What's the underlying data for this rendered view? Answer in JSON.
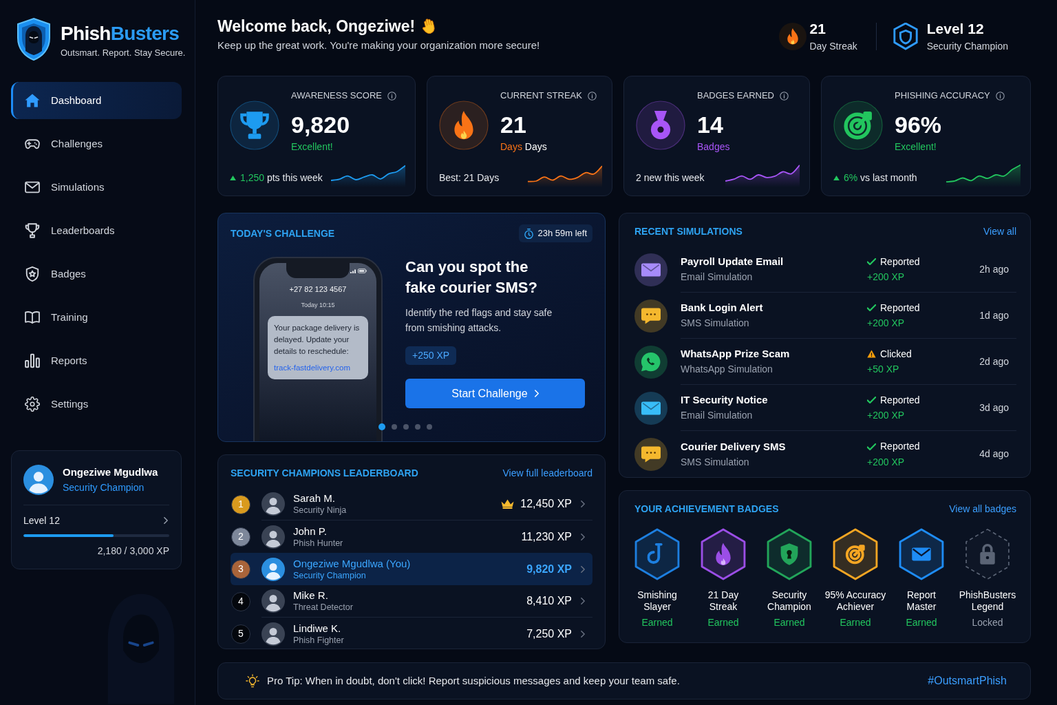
{
  "brand": {
    "name_start": "Phish",
    "name_end": "Busters",
    "tagline": "Outsmart. Report. Stay Secure."
  },
  "sidebar": {
    "items": [
      {
        "label": "Dashboard",
        "selected": true
      },
      {
        "label": "Challenges",
        "selected": false
      },
      {
        "label": "Simulations",
        "selected": false
      },
      {
        "label": "Leaderboards",
        "selected": false
      },
      {
        "label": "Badges",
        "selected": false
      },
      {
        "label": "Training",
        "selected": false
      },
      {
        "label": "Reports",
        "selected": false
      },
      {
        "label": "Settings",
        "selected": false
      }
    ],
    "profile": {
      "name": "Ongeziwe Mgudlwa",
      "role": "Security Champion",
      "level_label": "Level 12",
      "level": 0.62,
      "xp": "2,180 / 3,000 XP"
    }
  },
  "header": {
    "greeting": "Welcome back, Ongeziwe!",
    "subtitle": "Keep up the great work. You're making your organization more secure!",
    "streak": {
      "value": "21",
      "label": "Day Streak"
    },
    "rank": {
      "value": "Level 12",
      "label": "Security Champion"
    }
  },
  "stats": [
    {
      "title": "AWARENESS SCORE",
      "value": "9,820",
      "color": "#1d9bf0",
      "sub": {
        "accent": "Excellent!",
        "positive": true
      },
      "footer": {
        "trend_up": true,
        "accent": "1,250",
        "text": "pts this week"
      }
    },
    {
      "title": "CURRENT STREAK",
      "value": "21",
      "color": "#f97316",
      "sub": {
        "accent": "Days",
        "positive": false,
        "rest": "Days"
      },
      "footer": {
        "trend_up": false,
        "text": "Best: 21 Days"
      }
    },
    {
      "title": "BADGES EARNED",
      "value": "14",
      "color": "#a855f7",
      "sub": {
        "accent": "Badges",
        "positive": false
      },
      "footer": {
        "trend_up": false,
        "text": "2 new this week"
      }
    },
    {
      "title": "PHISHING ACCURACY",
      "value": "96%",
      "color": "#22c55e",
      "sub": {
        "accent": "Excellent!",
        "positive": true
      },
      "footer": {
        "trend_up": true,
        "accent": "6%",
        "text": "vs last month"
      }
    }
  ],
  "challenge": {
    "title": "TODAY'S CHALLENGE",
    "time_left": "23h 59m left",
    "sms": {
      "sender": "+27 82 123 4567",
      "time": "Today 10:15",
      "message": "Your package delivery is delayed. Update your details to reschedule:",
      "link": "track-fastdelivery.com"
    },
    "heading": "Can you spot the fake courier SMS?",
    "description": "Identify the red flags and stay safe from smishing attacks.",
    "xp": "+250 XP",
    "button": "Start Challenge",
    "dots": [
      {
        "selected": true
      },
      {
        "selected": false
      },
      {
        "selected": false
      },
      {
        "selected": false
      },
      {
        "selected": false
      }
    ]
  },
  "simulations": {
    "title": "RECENT SIMULATIONS",
    "link": "View all",
    "items": [
      {
        "title": "Payroll Update Email",
        "type": "Email Simulation",
        "kind": "email",
        "color": "#a78bfa",
        "status": "Reported",
        "reported": true,
        "xp": "+200 XP",
        "time": "2h ago"
      },
      {
        "title": "Bank Login Alert",
        "type": "SMS Simulation",
        "kind": "sms",
        "color": "#f5b82e",
        "status": "Reported",
        "reported": true,
        "xp": "+200 XP",
        "time": "1d ago"
      },
      {
        "title": "WhatsApp Prize Scam",
        "type": "WhatsApp Simulation",
        "kind": "whatsapp",
        "color": "#25c46a",
        "status": "Clicked",
        "reported": false,
        "xp": "+50 XP",
        "time": "2d ago"
      },
      {
        "title": "IT Security Notice",
        "type": "Email Simulation",
        "kind": "email",
        "color": "#38bdf8",
        "status": "Reported",
        "reported": true,
        "xp": "+200 XP",
        "time": "3d ago"
      },
      {
        "title": "Courier Delivery SMS",
        "type": "SMS Simulation",
        "kind": "sms",
        "color": "#f5b82e",
        "status": "Reported",
        "reported": true,
        "xp": "+200 XP",
        "time": "4d ago"
      }
    ]
  },
  "leaderboard": {
    "title": "SECURITY CHAMPIONS LEADERBOARD",
    "link": "View full leaderboard",
    "rows": [
      {
        "rank": "1",
        "color": "#d99a1e",
        "name": "Sarah M.",
        "role": "Security Ninja",
        "xp": "12,450 XP",
        "crown": true,
        "selected": false
      },
      {
        "rank": "2",
        "color": "#7d879a",
        "name": "John P.",
        "role": "Phish Hunter",
        "xp": "11,230 XP",
        "crown": false,
        "selected": false
      },
      {
        "rank": "3",
        "color": "#a9643a",
        "name": "Ongeziwe Mgudlwa (You)",
        "role": "Security Champion",
        "xp": "9,820 XP",
        "crown": false,
        "selected": true
      },
      {
        "rank": "4",
        "color": "#04070d",
        "name": "Mike R.",
        "role": "Threat Detector",
        "xp": "8,410 XP",
        "crown": false,
        "selected": false
      },
      {
        "rank": "5",
        "color": "#04070d",
        "name": "Lindiwe K.",
        "role": "Phish Fighter",
        "xp": "7,250 XP",
        "crown": false,
        "selected": false
      }
    ]
  },
  "badges": {
    "title": "YOUR ACHIEVEMENT BADGES",
    "link": "View all badges",
    "items": [
      {
        "label": "Smishing\nSlayer",
        "status": "Earned",
        "earned": true,
        "color": "#1d7fe0"
      },
      {
        "label": "21 Day\nStreak",
        "status": "Earned",
        "earned": true,
        "color": "#9b4ee6"
      },
      {
        "label": "Security\nChampion",
        "status": "Earned",
        "earned": true,
        "color": "#22a55a"
      },
      {
        "label": "95% Accuracy\nAchiever",
        "status": "Earned",
        "earned": true,
        "color": "#f5a623"
      },
      {
        "label": "Report\nMaster",
        "status": "Earned",
        "earned": true,
        "color": "#1e8cf5"
      },
      {
        "label": "PhishBusters\nLegend",
        "status": "Locked",
        "earned": false,
        "color": "#5b6475"
      }
    ]
  },
  "tip": {
    "text": "Pro Tip: When in doubt, don't click! Report suspicious messages and keep your team safe.",
    "hashtag": "#OutsmartPhish"
  }
}
